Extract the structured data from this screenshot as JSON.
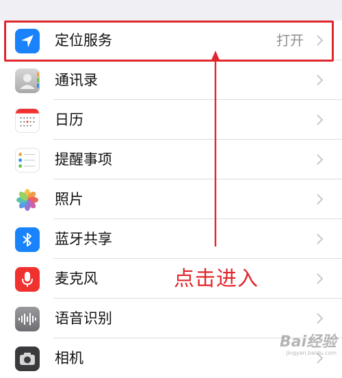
{
  "settings": {
    "items": [
      {
        "label": "定位服务",
        "value": "打开",
        "icon": "location-arrow-icon",
        "color": "#1a82fb"
      },
      {
        "label": "通讯录",
        "value": "",
        "icon": "contacts-icon",
        "color": "#b8b8b8"
      },
      {
        "label": "日历",
        "value": "",
        "icon": "calendar-icon",
        "color": "#ffffff"
      },
      {
        "label": "提醒事项",
        "value": "",
        "icon": "reminders-icon",
        "color": "#ffffff"
      },
      {
        "label": "照片",
        "value": "",
        "icon": "photos-icon",
        "color": "#ffffff"
      },
      {
        "label": "蓝牙共享",
        "value": "",
        "icon": "bluetooth-icon",
        "color": "#1a82fb"
      },
      {
        "label": "麦克风",
        "value": "",
        "icon": "microphone-icon",
        "color": "#f0312f"
      },
      {
        "label": "语音识别",
        "value": "",
        "icon": "speech-recognition-icon",
        "color": "#8a8a8e"
      },
      {
        "label": "相机",
        "value": "",
        "icon": "camera-icon",
        "color": "#3a3a3c"
      }
    ]
  },
  "annotation": {
    "text": "点击进入",
    "color": "#e0262b"
  },
  "watermark": {
    "main": "Bai经验",
    "sub": "jingyan.baidu.com"
  }
}
